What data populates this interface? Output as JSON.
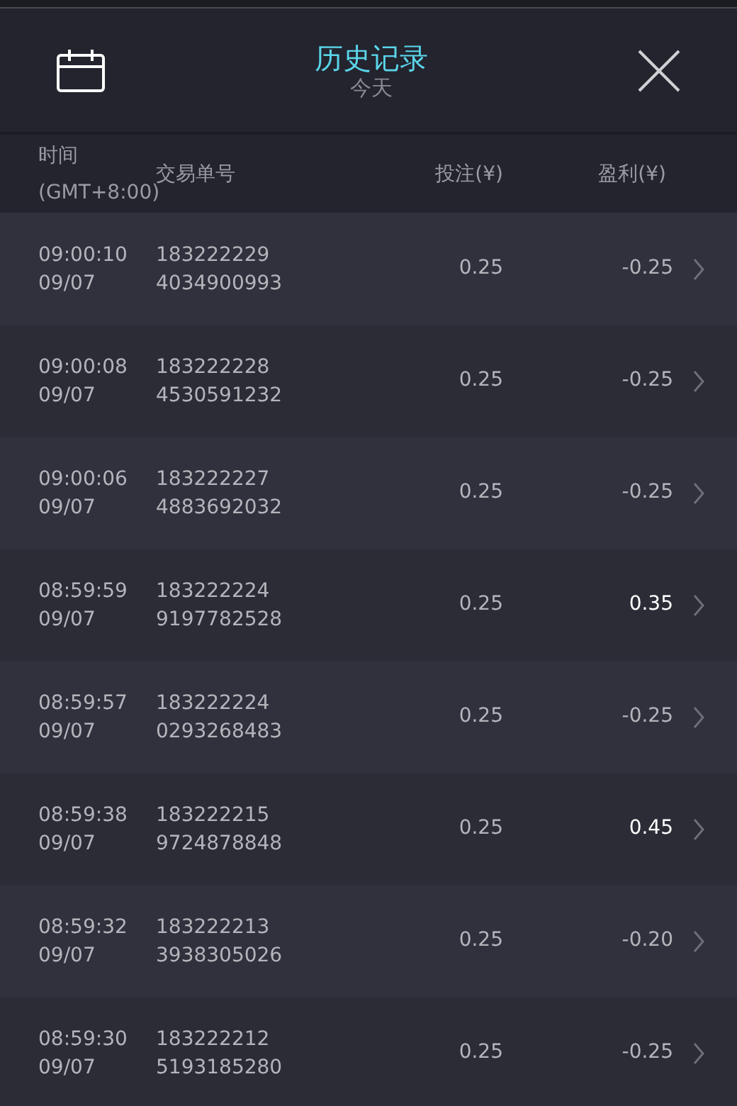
{
  "header": {
    "title": "历史记录",
    "subtitle": "今天"
  },
  "columns": [
    {
      "lines": [
        "时间",
        "(GMT+8:00)"
      ]
    },
    {
      "lines": [
        "交易单号"
      ]
    },
    {
      "lines": [
        "投注(¥)"
      ]
    },
    {
      "lines": [
        "盈利(¥)"
      ]
    }
  ],
  "rows": [
    {
      "time": "09:00:10",
      "date": "09/07",
      "order_1": "183222229",
      "order_2": "4034900993",
      "stake": "0.25",
      "profit": "-0.25",
      "kind": "loss"
    },
    {
      "time": "09:00:08",
      "date": "09/07",
      "order_1": "183222228",
      "order_2": "4530591232",
      "stake": "0.25",
      "profit": "-0.25",
      "kind": "loss"
    },
    {
      "time": "09:00:06",
      "date": "09/07",
      "order_1": "183222227",
      "order_2": "4883692032",
      "stake": "0.25",
      "profit": "-0.25",
      "kind": "loss"
    },
    {
      "time": "08:59:59",
      "date": "09/07",
      "order_1": "183222224",
      "order_2": "9197782528",
      "stake": "0.25",
      "profit": "0.35",
      "kind": "win"
    },
    {
      "time": "08:59:57",
      "date": "09/07",
      "order_1": "183222224",
      "order_2": "0293268483",
      "stake": "0.25",
      "profit": "-0.25",
      "kind": "loss"
    },
    {
      "time": "08:59:38",
      "date": "09/07",
      "order_1": "183222215",
      "order_2": "9724878848",
      "stake": "0.25",
      "profit": "0.45",
      "kind": "win"
    },
    {
      "time": "08:59:32",
      "date": "09/07",
      "order_1": "183222213",
      "order_2": "3938305026",
      "stake": "0.25",
      "profit": "-0.20",
      "kind": "loss"
    },
    {
      "time": "08:59:30",
      "date": "09/07",
      "order_1": "183222212",
      "order_2": "5193185280",
      "stake": "0.25",
      "profit": "-0.25",
      "kind": "loss"
    }
  ]
}
